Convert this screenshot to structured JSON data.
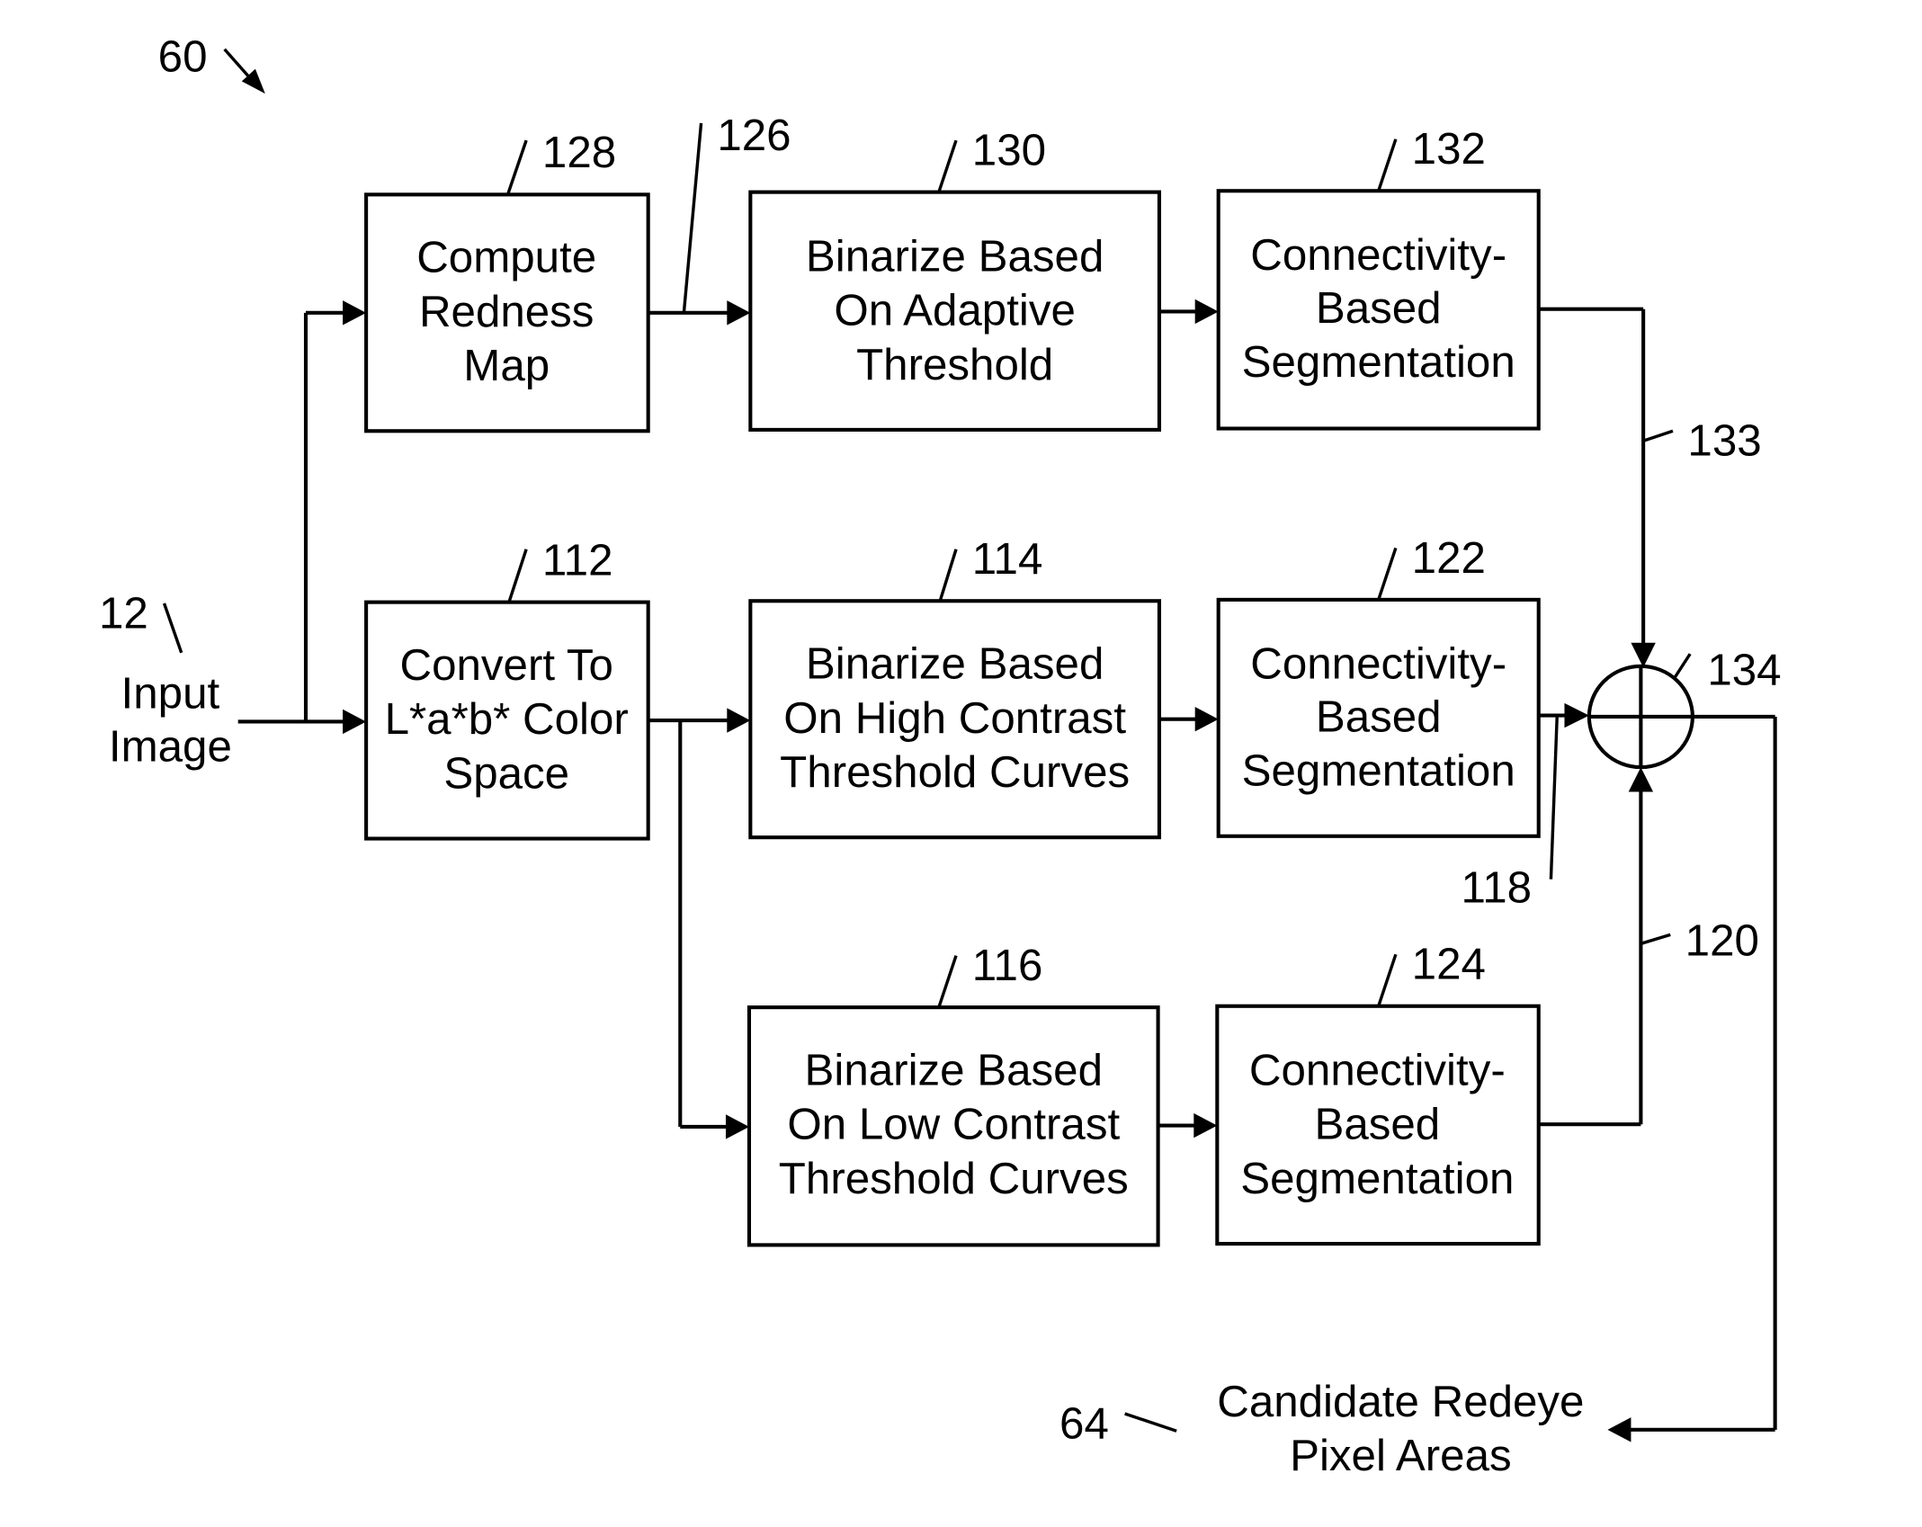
{
  "figure": {
    "ref": "60",
    "input": {
      "ref": "12",
      "lines": [
        "Input",
        "Image"
      ]
    },
    "output": {
      "ref": "64",
      "lines": [
        "Candidate Redeye",
        "Pixel Areas"
      ]
    },
    "blocks": {
      "b128": {
        "ref": "128",
        "lines": [
          "Compute",
          "Redness",
          "Map"
        ]
      },
      "b130": {
        "ref": "130",
        "lines": [
          "Binarize Based",
          "On Adaptive",
          "Threshold"
        ]
      },
      "b132": {
        "ref": "132",
        "lines": [
          "Connectivity-",
          "Based",
          "Segmentation"
        ]
      },
      "b112": {
        "ref": "112",
        "lines": [
          "Convert To",
          "L*a*b* Color",
          "Space"
        ]
      },
      "b114": {
        "ref": "114",
        "lines": [
          "Binarize Based",
          "On High Contrast",
          "Threshold Curves"
        ]
      },
      "b122": {
        "ref": "122",
        "lines": [
          "Connectivity-",
          "Based",
          "Segmentation"
        ]
      },
      "b116": {
        "ref": "116",
        "lines": [
          "Binarize Based",
          "On Low Contrast",
          "Threshold Curves"
        ]
      },
      "b124": {
        "ref": "124",
        "lines": [
          "Connectivity-",
          "Based",
          "Segmentation"
        ]
      }
    },
    "signals": {
      "s126": "126",
      "s133": "133",
      "s118": "118",
      "s120": "120"
    },
    "combiner": {
      "ref": "134"
    }
  }
}
